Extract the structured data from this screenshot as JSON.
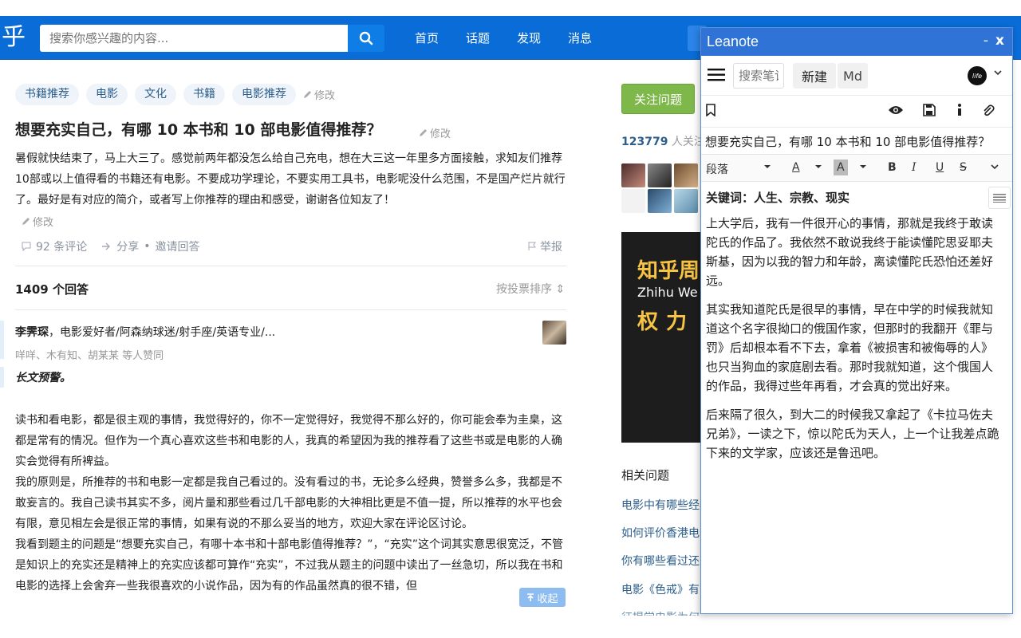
{
  "navbar": {
    "logo": "乎",
    "search_placeholder": "搜索你感兴趣的内容...",
    "items": [
      "首页",
      "话题",
      "发现",
      "消息"
    ],
    "color": "#0a6cd6"
  },
  "question": {
    "tags": [
      "书籍推荐",
      "电影",
      "文化",
      "书籍",
      "电影推荐"
    ],
    "edit_label": "修改",
    "title": "想要充实自己，有哪 10 本书和 10 部电影值得推荐？",
    "detail": "暑假就快结束了，马上大三了。感觉前两年都没怎么给自己充电，想在大三这一年里多方面接触，求知友们推荐10部或以上值得看的书籍还有电影。不要成功学理论，不要实用工具书，电影呢没什么范围，不是国产烂片就行了。最好是有对应的简介，或者写上你推荐的理由和感受，谢谢各位知友了！",
    "comments": "92 条评论",
    "share": "分享",
    "dot": "•",
    "invite": "邀请回答",
    "report": "举报",
    "answers_count": "1409 个回答",
    "sort": "按投票排序 ⇕"
  },
  "answer": {
    "author_name": "李霁琛",
    "author_bio": "，电影爱好者/阿森纳球迷/射手座/英语专业/...",
    "voters": "咩咩、木有知、胡某某 等人赞同",
    "warning": "长文预警。",
    "paragraphs": [
      "读书和看电影，都是很主观的事情，我觉得好的，你不一定觉得好，我觉得不那么好的，你可能会奉为圭臬，这都是常有的情况。但作为一个真心喜欢这些书和电影的人，我真的希望因为我的推荐看了这些书或是电影的人确实会觉得有所裨益。",
      "我的原则是，所推荐的书和电影一定都是我自己看过的。没有看过的书，无论多么经典，赞誉多么多，我都是不敢妄言的。我自己读书其实不多，阅片量和那些看过几千部电影的大神相比更是不值一提，所以推荐的水平也会有限，意见相左会是很正常的事情，如果有说的不那么妥当的地方，欢迎大家在评论区讨论。",
      "我看到题主的问题是“想要充实自己，有哪十本书和十部电影值得推荐？”，“充实”这个词其实意思很宽泛，不管是知识上的充实还是精神上的充实应该都可算作“充实”，不过我从题主的问题中读出了一丝急切，所以我在书和电影的选择上会舍弃一些我很喜欢的小说作品，因为有的作品虽然真的很不错，但"
    ],
    "collapse": "收起"
  },
  "sidebar": {
    "follow_button": "关注问题",
    "followers_count": "123779",
    "followers_suffix": " 人关注",
    "banner_line1": "知乎周",
    "banner_line2": "Zhihu We",
    "banner_line3": "权力",
    "related_title": "相关问题",
    "related": [
      "电影中有哪些经典",
      "如何评价香港电影",
      "你有哪些看过还",
      "电影《色戒》有",
      "征提学电影为何逐渐成为非善主抗"
    ]
  },
  "leanote": {
    "title": "Leanote",
    "minimize": "-",
    "close": "x",
    "search_placeholder": "搜索笔记",
    "new_label": "新建",
    "md_label": "Md",
    "user_initial": "life",
    "note_title": "想要充实自己，有哪 10 本书和 10 部电影值得推荐？",
    "format_paragraph": "段落",
    "keywords": "关键词：人生、宗教、现实",
    "paragraphs": [
      "上大学后，我有一件很开心的事情，那就是我终于敢读陀氏的作品了。我依然不敢说我终于能读懂陀思妥耶夫斯基，因为以我的智力和年龄，离读懂陀氏恐怕还差好远。",
      "其实我知道陀氏是很早的事情，早在中学的时候我就知道这个名字很拗口的俄国作家，但那时的我翻开《罪与罚》后却根本看不下去，拿着《被损害和被侮辱的人》也只当狗血的家庭剧去看。那时我就知道，这个俄国人的作品，我得过些年再看，才会真的觉出好来。",
      "后来隔了很久，到大二的时候我又拿起了《卡拉马佐夫兄弟》，一读之下，惊以陀氏为天人，上一个让我差点跪下来的文学家，应该还是鲁迅吧。"
    ],
    "color": "#2f73d6"
  }
}
